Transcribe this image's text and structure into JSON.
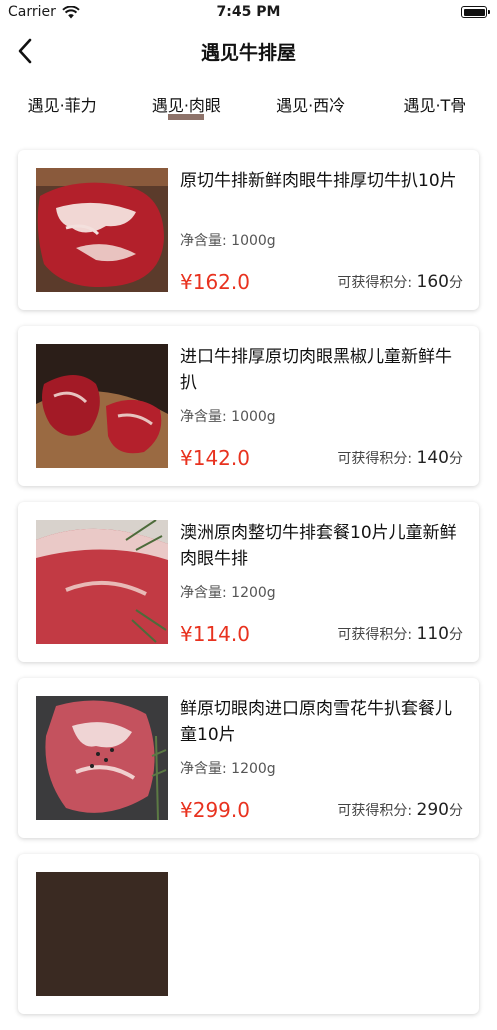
{
  "status_bar": {
    "carrier": "Carrier",
    "time": "7:45 PM"
  },
  "nav": {
    "title": "遇见牛排屋"
  },
  "tabs": [
    {
      "label": "遇见·菲力",
      "active": false
    },
    {
      "label": "遇见·肉眼",
      "active": true
    },
    {
      "label": "遇见·西冷",
      "active": false
    },
    {
      "label": "遇见·T骨",
      "active": false
    }
  ],
  "labels": {
    "net_prefix": "净含量: ",
    "points_prefix": "可获得积分: "
  },
  "products": [
    {
      "title": "原切牛排新鲜肉眼牛排厚切牛扒10片",
      "net": "1000g",
      "price": "¥162.0",
      "points": "160",
      "points_unit": "分"
    },
    {
      "title": "进口牛排厚原切肉眼黑椒儿童新鲜牛扒",
      "net": "1000g",
      "price": "¥142.0",
      "points": "140",
      "points_unit": "分"
    },
    {
      "title": "澳洲原肉整切牛排套餐10片儿童新鲜肉眼牛排",
      "net": "1200g",
      "price": "¥114.0",
      "points": "110",
      "points_unit": "分"
    },
    {
      "title": "鲜原切眼肉进口原肉雪花牛扒套餐儿童10片",
      "net": "1200g",
      "price": "¥299.0",
      "points": "290",
      "points_unit": "分"
    }
  ],
  "colors": {
    "price": "#e8321f",
    "tab_indicator": "#7a5a50"
  }
}
